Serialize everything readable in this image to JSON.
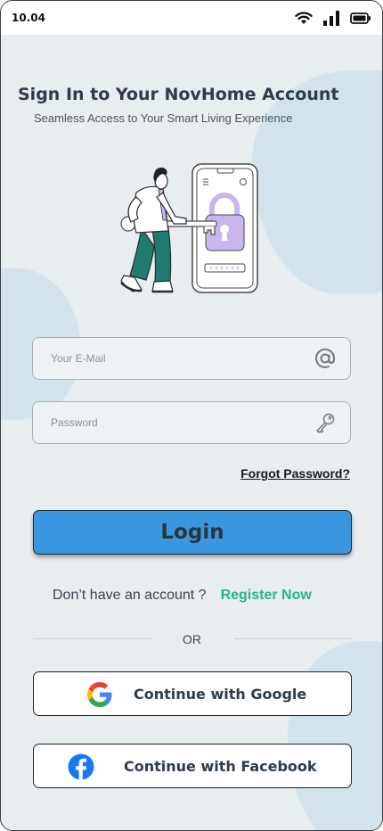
{
  "status_bar": {
    "time": "10.04"
  },
  "header": {
    "title": "Sign In to Your NovHome Account",
    "subtitle": "Seamless Access to Your Smart Living Experience"
  },
  "form": {
    "email_placeholder": "Your E-Mail",
    "email_value": "",
    "password_placeholder": "Password",
    "password_value": "",
    "forgot_label": "Forgot Password?",
    "login_label": "Login"
  },
  "register": {
    "question": "Don’t have an account ?",
    "link_label": "Register Now"
  },
  "divider": {
    "label": "OR"
  },
  "social": {
    "google_label": "Continue with Google",
    "facebook_label": "Continue with Facebook"
  },
  "colors": {
    "background": "#e8edf0",
    "primary": "#3b97dd",
    "accent_green": "#27b486",
    "lock_purple": "#c9b6ee",
    "facebook_blue": "#1877f2"
  },
  "icons": {
    "email": "at-sign-icon",
    "password": "key-icon",
    "google": "google-logo-icon",
    "facebook": "facebook-logo-icon"
  }
}
